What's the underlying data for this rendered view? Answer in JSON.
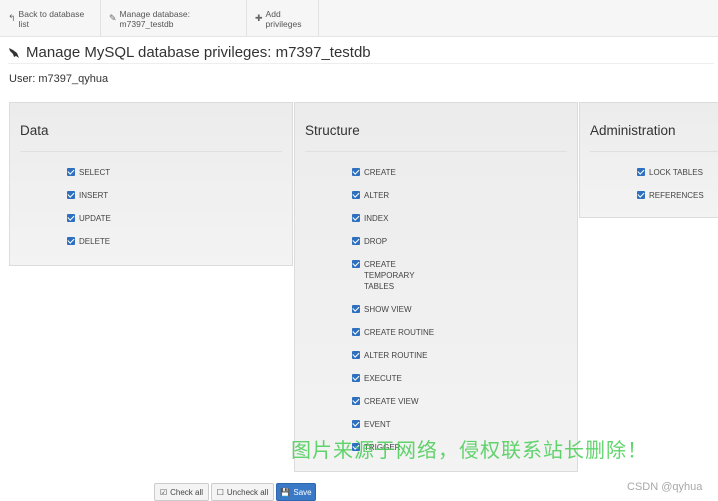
{
  "nav": {
    "items": [
      {
        "label": "Back to database list",
        "icon": "back-arrow-icon",
        "glyph": "↰"
      },
      {
        "label": "Manage database: m7397_testdb",
        "icon": "edit-icon",
        "glyph": "✎"
      },
      {
        "label": "Add privileges",
        "icon": "plus-icon",
        "glyph": "✚"
      }
    ]
  },
  "page": {
    "title": "Manage MySQL database privileges: m7397_testdb",
    "user_label": "User:",
    "user_value": "m7397_qyhua"
  },
  "groups": [
    {
      "title": "Data",
      "items": [
        "SELECT",
        "INSERT",
        "UPDATE",
        "DELETE"
      ]
    },
    {
      "title": "Structure",
      "items": [
        "CREATE",
        "ALTER",
        "INDEX",
        "DROP",
        "CREATE TEMPORARY TABLES",
        "SHOW VIEW",
        "CREATE ROUTINE",
        "ALTER ROUTINE",
        "EXECUTE",
        "CREATE VIEW",
        "EVENT",
        "TRIGGER"
      ]
    },
    {
      "title": "Administration",
      "items": [
        "LOCK TABLES",
        "REFERENCES"
      ]
    }
  ],
  "buttons": {
    "check_all": "Check all",
    "uncheck_all": "Uncheck all",
    "save": "Save"
  },
  "overlay": {
    "watermark": "图片来源于网络，侵权联系站长删除！",
    "credit": "CSDN @qyhua"
  },
  "colors": {
    "checkbox": "#2f6fc0",
    "save_button": "#3a79c6",
    "watermark": "#46cd55"
  }
}
